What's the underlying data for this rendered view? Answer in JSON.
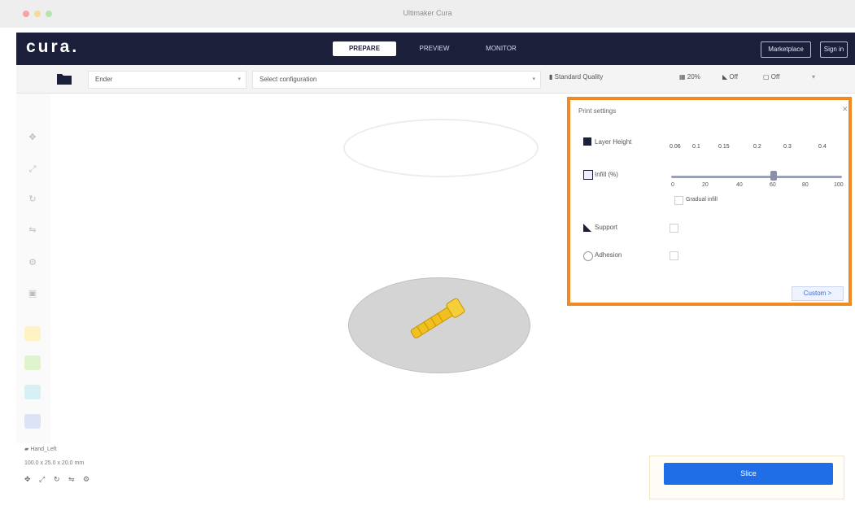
{
  "window": {
    "title": "Ultimaker Cura"
  },
  "header": {
    "logo": "cura.",
    "tabs": [
      {
        "label": "PREPARE",
        "active": true
      },
      {
        "label": "PREVIEW",
        "active": false
      },
      {
        "label": "MONITOR",
        "active": false
      }
    ],
    "right_buttons": [
      "Marketplace",
      "Sign in"
    ]
  },
  "toolbar": {
    "printer_select": "Ender",
    "config_select": "Select configuration",
    "profile_label": "Standard Quality",
    "support_value": "20%",
    "adhesion_value": "Off",
    "supports_value": "Off"
  },
  "print_settings": {
    "title": "Print settings",
    "layer_height_label": "Layer Height",
    "layer_height_values": [
      "0.06",
      "0.1",
      "0.15",
      "0.2",
      "0.3",
      "0.4"
    ],
    "infill_label": "Infill (%)",
    "infill_ticks": [
      "0",
      "20",
      "40",
      "60",
      "80",
      "100"
    ],
    "infill_percent": 60,
    "gradual_infill_label": "Gradual infill",
    "support_label": "Support",
    "adhesion_label": "Adhesion",
    "custom_button": "Custom >"
  },
  "bottom_left": {
    "object_name": "Hand_Left",
    "dimensions": "100.0 x 25.0 x 20.0 mm",
    "icons": [
      "move-icon",
      "scale-icon",
      "rotate-icon",
      "mirror-icon",
      "per-model-icon"
    ]
  },
  "slice": {
    "button_label": "Slice"
  },
  "colors": {
    "header_bg": "#1c1f3a",
    "accent_blue": "#1f6ee8",
    "panel_border": "#f08a24",
    "model_yellow": "#f0c020"
  }
}
